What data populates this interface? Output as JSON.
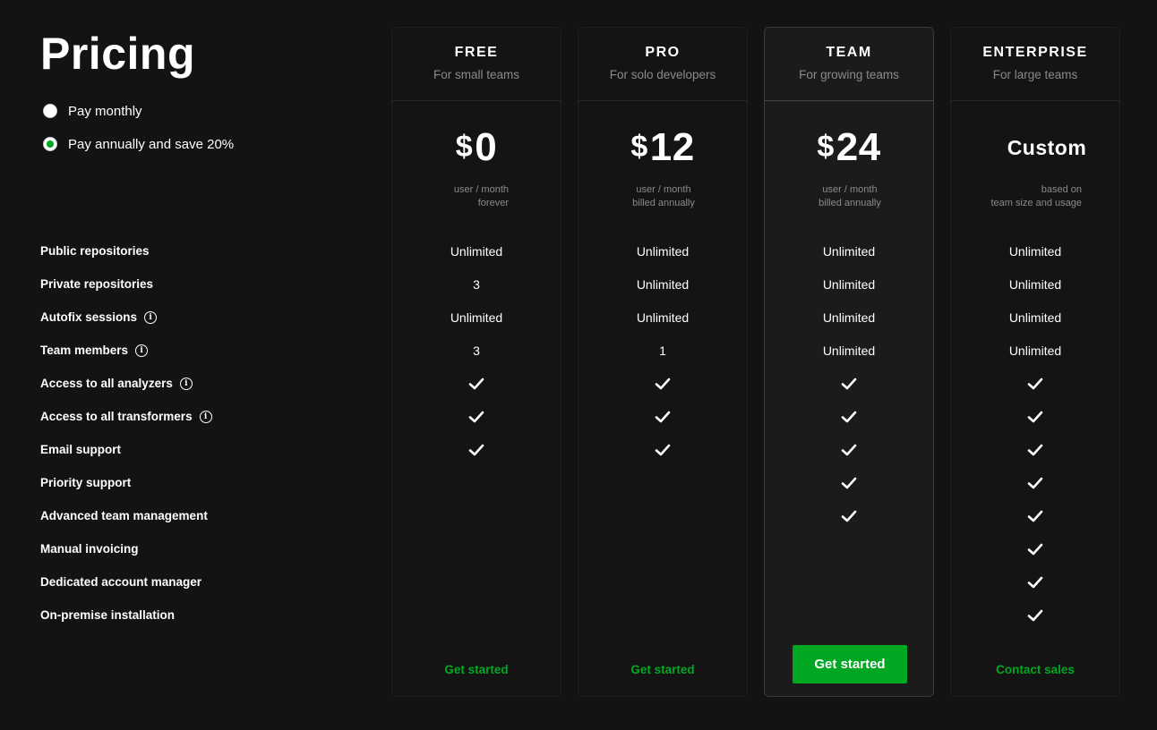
{
  "page": {
    "title": "Pricing"
  },
  "billing": {
    "options": [
      {
        "label": "Pay monthly",
        "selected": false
      },
      {
        "label": "Pay annually and save 20%",
        "selected": true
      }
    ]
  },
  "features": [
    {
      "label": "Public repositories",
      "info": false
    },
    {
      "label": "Private repositories",
      "info": false
    },
    {
      "label": "Autofix sessions",
      "info": true
    },
    {
      "label": "Team members",
      "info": true
    },
    {
      "label": "Access to all analyzers",
      "info": true
    },
    {
      "label": "Access to all transformers",
      "info": true
    },
    {
      "label": "Email support",
      "info": false
    },
    {
      "label": "Priority support",
      "info": false
    },
    {
      "label": "Advanced team management",
      "info": false
    },
    {
      "label": "Manual invoicing",
      "info": false
    },
    {
      "label": "Dedicated account manager",
      "info": false
    },
    {
      "label": "On-premise installation",
      "info": false
    }
  ],
  "plans": [
    {
      "name": "FREE",
      "description": "For small teams",
      "currency": "$",
      "price": "0",
      "note": [
        "user / month",
        "forever"
      ],
      "values": [
        "Unlimited",
        "3",
        "Unlimited",
        "3",
        "check",
        "check",
        "check",
        "",
        "",
        "",
        "",
        ""
      ],
      "cta": "Get started",
      "cta_style": "link",
      "highlight": false
    },
    {
      "name": "PRO",
      "description": "For solo developers",
      "currency": "$",
      "price": "12",
      "note": [
        "user / month",
        "billed annually"
      ],
      "values": [
        "Unlimited",
        "Unlimited",
        "Unlimited",
        "1",
        "check",
        "check",
        "check",
        "",
        "",
        "",
        "",
        ""
      ],
      "cta": "Get started",
      "cta_style": "link",
      "highlight": false
    },
    {
      "name": "TEAM",
      "description": "For growing teams",
      "currency": "$",
      "price": "24",
      "note": [
        "user / month",
        "billed annually"
      ],
      "values": [
        "Unlimited",
        "Unlimited",
        "Unlimited",
        "Unlimited",
        "check",
        "check",
        "check",
        "check",
        "check",
        "",
        "",
        ""
      ],
      "cta": "Get started",
      "cta_style": "button",
      "highlight": true
    },
    {
      "name": "ENTERPRISE",
      "description": "For large teams",
      "currency": "",
      "price": "Custom",
      "note": [
        "based on",
        "team size and usage"
      ],
      "values": [
        "Unlimited",
        "Unlimited",
        "Unlimited",
        "Unlimited",
        "check",
        "check",
        "check",
        "check",
        "check",
        "check",
        "check",
        "check"
      ],
      "cta": "Contact sales",
      "cta_style": "link",
      "highlight": false
    }
  ],
  "colors": {
    "background": "#131313",
    "accent": "#00a722",
    "muted_text": "#8a8a8a"
  }
}
